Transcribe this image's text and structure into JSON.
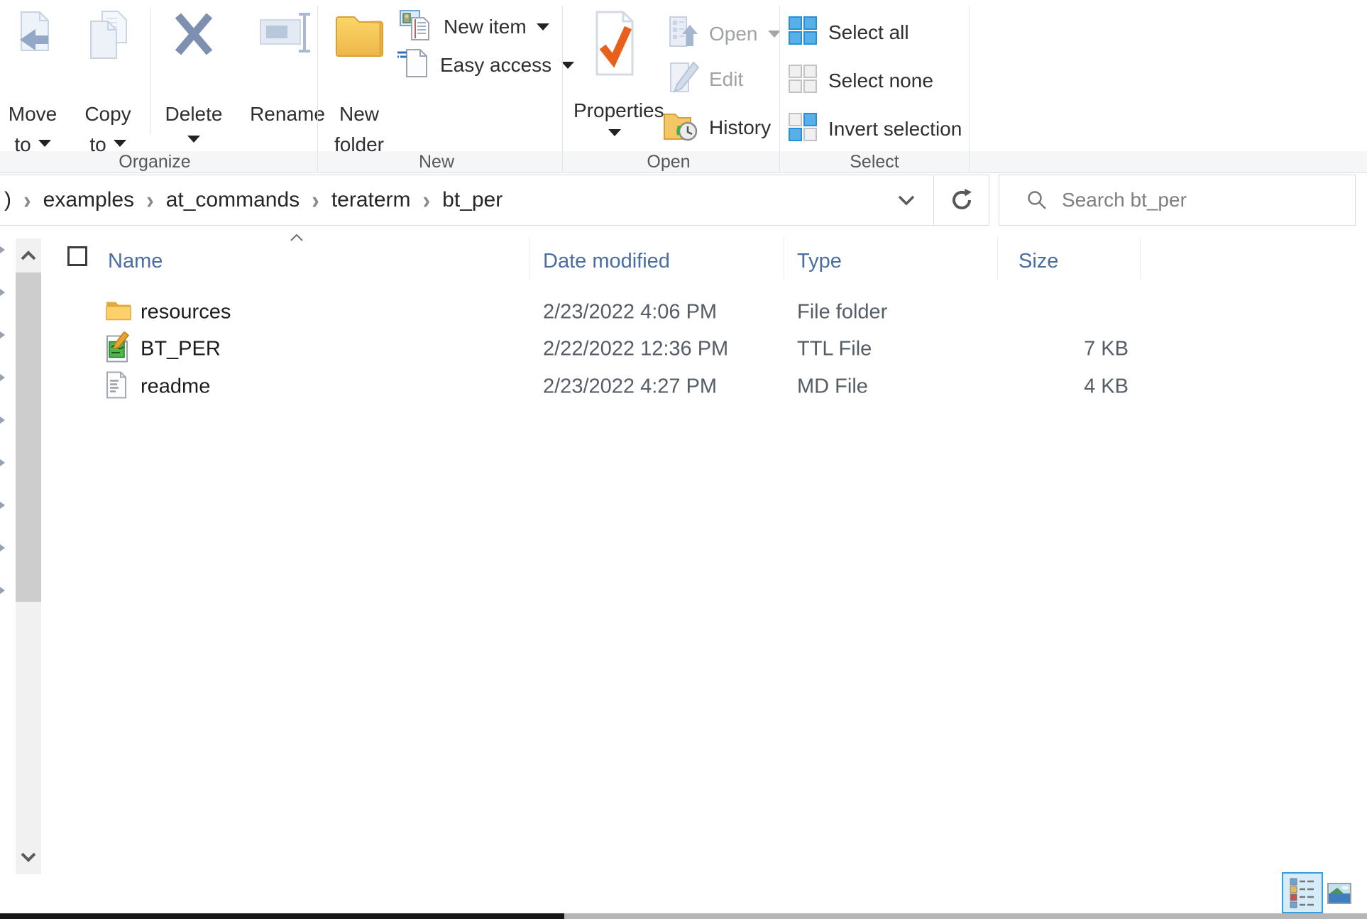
{
  "ribbon": {
    "organize": {
      "label": "Organize",
      "move_to": "Move to",
      "copy_to": "Copy to",
      "delete": "Delete",
      "rename": "Rename"
    },
    "new": {
      "label": "New",
      "new_folder": "New folder",
      "new_item": "New item",
      "easy_access": "Easy access"
    },
    "open": {
      "label": "Open",
      "properties": "Properties",
      "open": "Open",
      "edit": "Edit",
      "history": "History"
    },
    "select": {
      "label": "Select",
      "select_all": "Select all",
      "select_none": "Select none",
      "invert_selection": "Invert selection"
    }
  },
  "address_bar": {
    "separator": "›",
    "segments": [
      ")",
      "examples",
      "at_commands",
      "teraterm",
      "bt_per"
    ]
  },
  "search": {
    "placeholder": "Search bt_per"
  },
  "file_list": {
    "columns": [
      "Name",
      "Date modified",
      "Type",
      "Size"
    ],
    "rows": [
      {
        "icon": "folder-icon",
        "name": "resources",
        "date_modified": "2/23/2022 4:06 PM",
        "type": "File folder",
        "size": ""
      },
      {
        "icon": "ttl-file-icon",
        "name": "BT_PER",
        "date_modified": "2/22/2022 12:36 PM",
        "type": "TTL File",
        "size": "7 KB"
      },
      {
        "icon": "md-file-icon",
        "name": "readme",
        "date_modified": "2/23/2022 4:27 PM",
        "type": "MD File",
        "size": "4 KB"
      }
    ]
  },
  "colors": {
    "accent_blue": "#35a0dc",
    "header_text": "#4a6da2",
    "select_icon_blue": "#57b1e8",
    "properties_check": "#e8611c",
    "folder_yellow": "#fcd06a",
    "delete_x": "#7e90af"
  }
}
